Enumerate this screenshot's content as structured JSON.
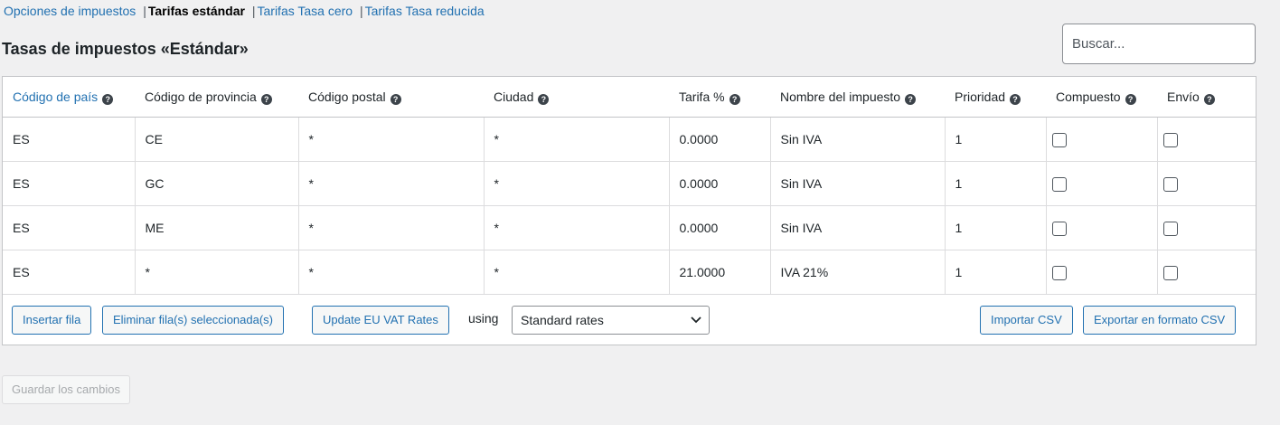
{
  "subnav": {
    "items": [
      {
        "label": "Opciones de impuestos",
        "current": false
      },
      {
        "label": "Tarifas estándar",
        "current": true
      },
      {
        "label": "Tarifas Tasa cero",
        "current": false
      },
      {
        "label": "Tarifas Tasa reducida",
        "current": false
      }
    ],
    "separator": "|"
  },
  "page_title": "Tasas de impuestos «Estándar»",
  "search": {
    "placeholder": "Buscar...",
    "value": ""
  },
  "table": {
    "columns": [
      {
        "label": "Código de país",
        "sortable": true
      },
      {
        "label": "Código de provincia",
        "sortable": false
      },
      {
        "label": "Código postal",
        "sortable": false
      },
      {
        "label": "Ciudad",
        "sortable": false
      },
      {
        "label": "Tarifa %",
        "sortable": false
      },
      {
        "label": "Nombre del impuesto",
        "sortable": false
      },
      {
        "label": "Prioridad",
        "sortable": false
      },
      {
        "label": "Compuesto",
        "sortable": false
      },
      {
        "label": "Envío",
        "sortable": false
      }
    ],
    "help_icon": "?",
    "rows": [
      {
        "country": "ES",
        "state": "CE",
        "postcode": "*",
        "city": "*",
        "rate": "0.0000",
        "name": "Sin IVA",
        "priority": "1",
        "compound": false,
        "shipping": false
      },
      {
        "country": "ES",
        "state": "GC",
        "postcode": "*",
        "city": "*",
        "rate": "0.0000",
        "name": "Sin IVA",
        "priority": "1",
        "compound": false,
        "shipping": false
      },
      {
        "country": "ES",
        "state": "ME",
        "postcode": "*",
        "city": "*",
        "rate": "0.0000",
        "name": "Sin IVA",
        "priority": "1",
        "compound": false,
        "shipping": false
      },
      {
        "country": "ES",
        "state": "*",
        "postcode": "*",
        "city": "*",
        "rate": "21.0000",
        "name": "IVA 21%",
        "priority": "1",
        "compound": false,
        "shipping": false
      }
    ]
  },
  "footer": {
    "insert_row": "Insertar fila",
    "remove_rows": "Eliminar fila(s) seleccionada(s)",
    "update_vat": "Update EU VAT Rates",
    "using_label": "using",
    "rates_select": {
      "selected": "Standard rates"
    },
    "import_csv": "Importar CSV",
    "export_csv": "Exportar en formato CSV"
  },
  "save_button": "Guardar los cambios",
  "colors": {
    "link": "#2271b1",
    "background": "#f0f0f1",
    "border": "#c3c4c7"
  }
}
